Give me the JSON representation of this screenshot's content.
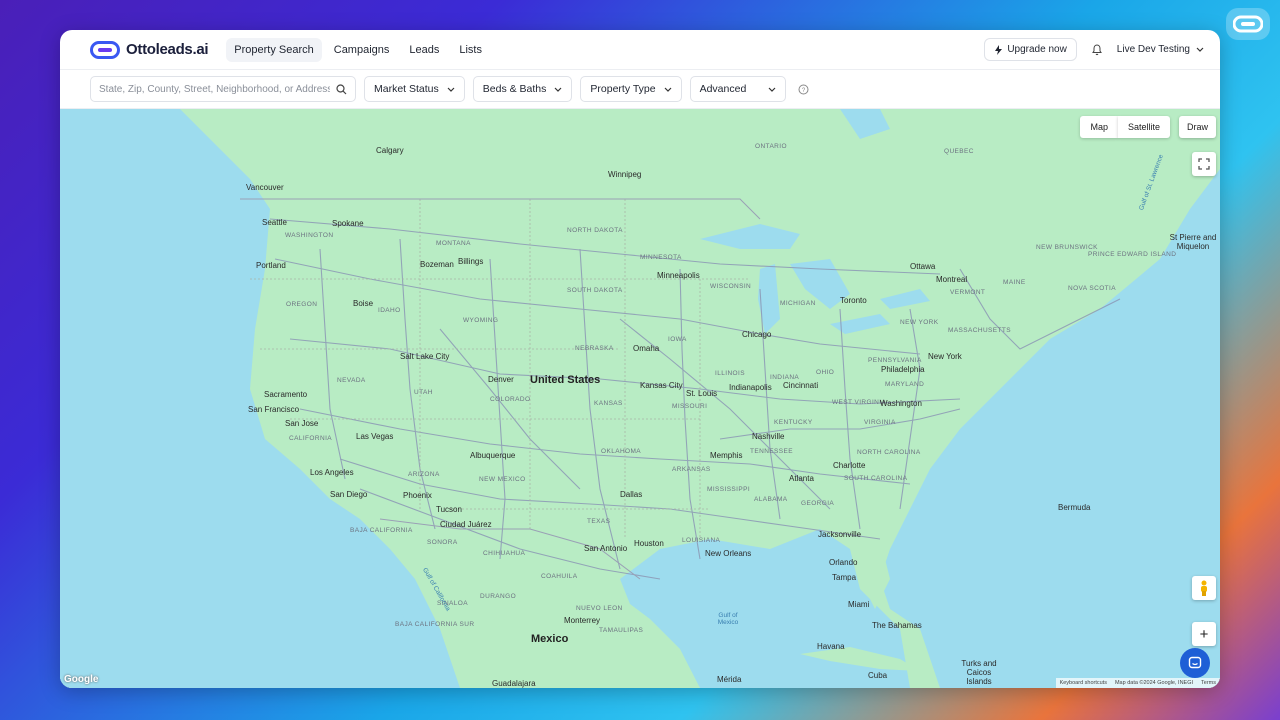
{
  "brand": {
    "name": "Ottoleads.ai"
  },
  "nav": [
    {
      "label": "Property Search"
    },
    {
      "label": "Campaigns"
    },
    {
      "label": "Leads"
    },
    {
      "label": "Lists"
    }
  ],
  "header": {
    "upgrade_label": "Upgrade now",
    "user_name": "Live Dev Testing"
  },
  "filters": {
    "search_placeholder": "State, Zip, County, Street, Neighborhood, or Address",
    "market_status": "Market Status",
    "beds_baths": "Beds & Baths",
    "property_type": "Property Type",
    "advanced": "Advanced"
  },
  "map_controls": {
    "map": "Map",
    "satellite": "Satellite",
    "draw": "Draw",
    "zoom_in": "+"
  },
  "attribution": {
    "shortcuts": "Keyboard shortcuts",
    "data": "Map data ©2024 Google, INEGI",
    "terms": "Terms",
    "logo": "Google"
  },
  "map_labels": {
    "countries": [
      "United States",
      "Mexico"
    ],
    "states": [
      "WASHINGTON",
      "MONTANA",
      "NORTH DAKOTA",
      "MINNESOTA",
      "OREGON",
      "IDAHO",
      "SOUTH DAKOTA",
      "WYOMING",
      "WISCONSIN",
      "MICHIGAN",
      "NEBRASKA",
      "IOWA",
      "NEVADA",
      "UTAH",
      "COLORADO",
      "KANSAS",
      "ILLINOIS",
      "INDIANA",
      "OHIO",
      "MISSOURI",
      "CALIFORNIA",
      "KENTUCKY",
      "ARIZONA",
      "OKLAHOMA",
      "TENNESSEE",
      "NEW MEXICO",
      "ARKANSAS",
      "MISSISSIPPI",
      "ALABAMA",
      "GEORGIA",
      "TEXAS",
      "LOUISIANA",
      "NEW YORK",
      "PENNSYLVANIA",
      "MAINE",
      "VERMONT",
      "ONTARIO",
      "QUEBEC",
      "NEW BRUNSWICK",
      "NOVA SCOTIA",
      "VIRGINIA",
      "WEST VIRGINIA",
      "NORTH CAROLINA",
      "SOUTH CAROLINA",
      "MARYLAND",
      "MASSACHUSETTS",
      "PRINCE EDWARD ISLAND",
      "SONORA",
      "CHIHUAHUA",
      "COAHUILA",
      "NUEVO LEON",
      "DURANGO",
      "SINALOA",
      "BAJA CALIFORNIA",
      "BAJA CALIFORNIA SUR",
      "TAMAULIPAS"
    ],
    "cities": [
      "Calgary",
      "Vancouver",
      "Winnipeg",
      "Seattle",
      "Spokane",
      "Portland",
      "Bozeman",
      "Billings",
      "Minneapolis",
      "Boise",
      "Salt Lake City",
      "Denver",
      "Omaha",
      "Chicago",
      "Toronto",
      "Ottawa",
      "Montreal",
      "Kansas City",
      "St. Louis",
      "Indianapolis",
      "Cincinnati",
      "Sacramento",
      "San Francisco",
      "San Jose",
      "Las Vegas",
      "Los Angeles",
      "San Diego",
      "Phoenix",
      "Albuquerque",
      "Tucson",
      "Ciudad Juárez",
      "Dallas",
      "Memphis",
      "Nashville",
      "Charlotte",
      "Atlanta",
      "Washington",
      "Philadelphia",
      "New York",
      "San Antonio",
      "Houston",
      "New Orleans",
      "Jacksonville",
      "Orlando",
      "Tampa",
      "Miami",
      "Monterrey",
      "Havana",
      "Mérida",
      "Cuba",
      "Guadalajara",
      "The Bahamas",
      "Bermuda",
      "St Pierre and Miquelon",
      "Turks and Caicos Islands"
    ],
    "water": [
      "Gulf of Mexico",
      "Gulf of California",
      "Gulf of St. Lawrence"
    ]
  },
  "colors": {
    "accent": "#3a58f2",
    "land": "#b8ecc4",
    "water": "#9ddcee",
    "road": "#8c98b5"
  }
}
